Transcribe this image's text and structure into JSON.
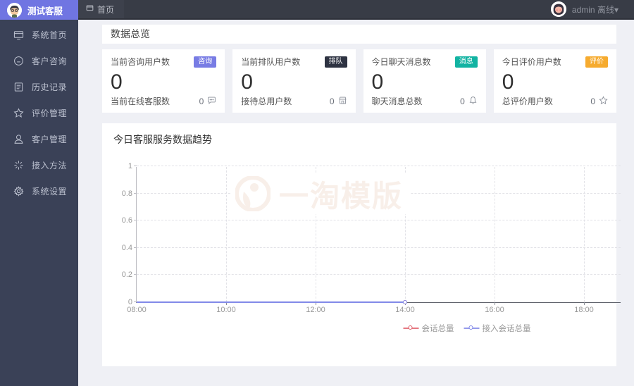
{
  "colors": {
    "brand_purple": "#7075e2",
    "sidebar_bg": "#3a4157",
    "topbar_bg": "#383c46",
    "badge_consult": "#787ce4",
    "badge_queue": "#2e3342",
    "badge_message": "#12b3a2",
    "badge_review": "#f6ab2f",
    "series_red": "#e0616c",
    "series_purple": "#8289e8"
  },
  "logo": {
    "title": "测试客服"
  },
  "topbar": {
    "tab": {
      "label": "首页",
      "icon": "home-tab-icon"
    },
    "user": {
      "name": "admin",
      "status": "离线",
      "arrow": "▾"
    }
  },
  "sidebar": {
    "items": [
      {
        "id": "home",
        "icon": "desktop-icon",
        "label": "系统首页"
      },
      {
        "id": "consult",
        "icon": "smiley-icon",
        "label": "客户咨询"
      },
      {
        "id": "history",
        "icon": "document-icon",
        "label": "历史记录"
      },
      {
        "id": "review",
        "icon": "star-icon",
        "label": "评价管理"
      },
      {
        "id": "customer",
        "icon": "user-icon",
        "label": "客户管理"
      },
      {
        "id": "access",
        "icon": "plugin-icon",
        "label": "接入方法"
      },
      {
        "id": "settings",
        "icon": "gear-icon",
        "label": "系统设置"
      }
    ]
  },
  "overview": {
    "title": "数据总览",
    "cards": [
      {
        "label": "当前咨询用户数",
        "badge": "咨询",
        "badge_color": "#787ce4",
        "value": "0",
        "sub_label": "当前在线客服数",
        "sub_value": "0",
        "icon": "chat-icon"
      },
      {
        "label": "当前排队用户数",
        "badge": "排队",
        "badge_color": "#2e3342",
        "value": "0",
        "sub_label": "接待总用户数",
        "sub_value": "0",
        "icon": "shop-icon"
      },
      {
        "label": "今日聊天消息数",
        "badge": "消息",
        "badge_color": "#12b3a2",
        "value": "0",
        "sub_label": "聊天消息总数",
        "sub_value": "0",
        "icon": "bell-icon"
      },
      {
        "label": "今日评价用户数",
        "badge": "评价",
        "badge_color": "#f6ab2f",
        "value": "0",
        "sub_label": "总评价用户数",
        "sub_value": "0",
        "icon": "star-outline-icon"
      }
    ]
  },
  "chart_section": {
    "title": "今日客服服务数据趋势"
  },
  "chart_data": {
    "type": "line",
    "title": "今日客服服务数据趋势",
    "x": [
      "08:00",
      "10:00",
      "12:00",
      "14:00",
      "16:00",
      "18:00"
    ],
    "y_ticks": [
      0,
      0.2,
      0.4,
      0.6,
      0.8,
      1
    ],
    "ylim": [
      0,
      1
    ],
    "grid": true,
    "legend_position": "bottom",
    "series": [
      {
        "name": "会话总量",
        "color": "#e0616c",
        "x_start": "08:00",
        "x_end": "14:00",
        "values": [
          0,
          0,
          0,
          0
        ]
      },
      {
        "name": "接入会话总量",
        "color": "#8289e8",
        "x_start": "08:00",
        "x_end": "14:00",
        "values": [
          0,
          0,
          0,
          0
        ]
      }
    ],
    "watermark": "一淘模版"
  }
}
